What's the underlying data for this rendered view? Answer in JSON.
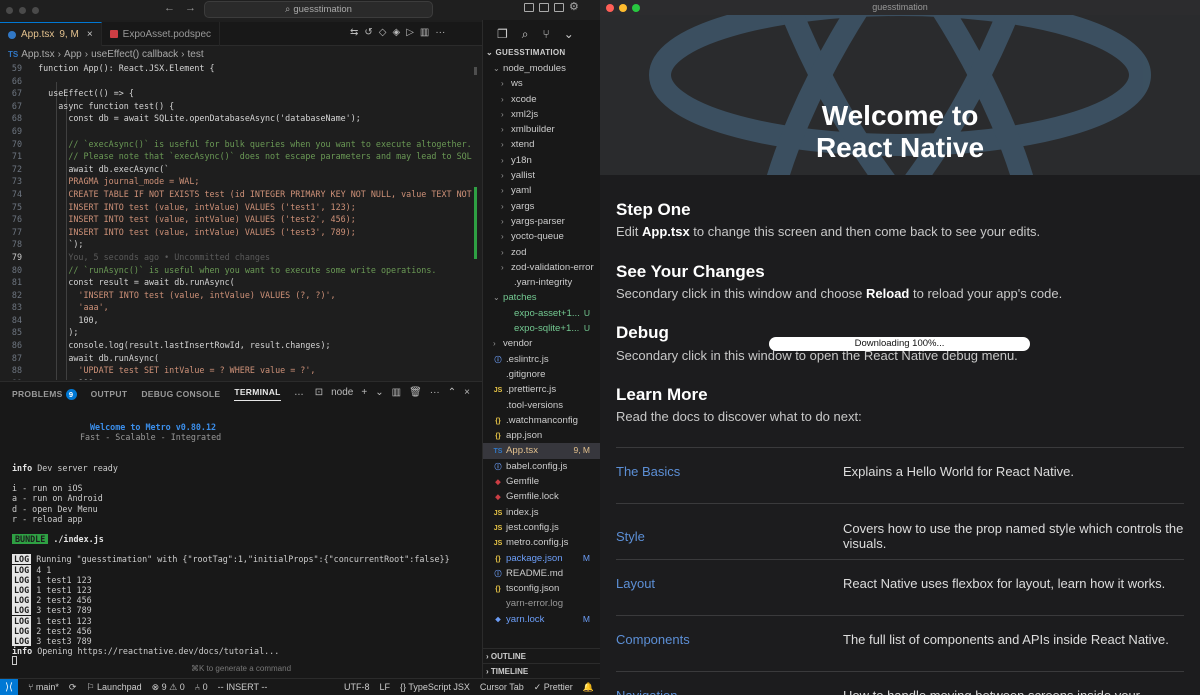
{
  "ide": {
    "search": "guesstimation",
    "tabs": [
      {
        "label": "App.tsx",
        "badge": "9, M",
        "close": "×"
      },
      {
        "label": "ExpoAsset.podspec"
      }
    ],
    "breadcrumb": [
      "App.tsx",
      "App",
      "useEffect() callback",
      "test"
    ],
    "code": [
      {
        "n": "59",
        "t": "  function App(): React.JSX.Element {",
        "k": ""
      },
      {
        "n": "66",
        "t": "",
        "k": ""
      },
      {
        "n": "67",
        "t": "    useEffect(() => {",
        "k": ""
      },
      {
        "n": "67",
        "t": "      async function test() {",
        "k": ""
      },
      {
        "n": "68",
        "t": "        const db = await SQLite.openDatabaseAsync('databaseName');",
        "k": ""
      },
      {
        "n": "69",
        "t": "",
        "k": ""
      },
      {
        "n": "70",
        "t": "        // `execAsync()` is useful for bulk queries when you want to execute altogether.",
        "k": "cmt"
      },
      {
        "n": "71",
        "t": "        // Please note that `execAsync()` does not escape parameters and may lead to SQL",
        "k": "cmt"
      },
      {
        "n": "72",
        "t": "        await db.execAsync(`",
        "k": ""
      },
      {
        "n": "73",
        "t": "        PRAGMA journal_mode = WAL;",
        "k": "str"
      },
      {
        "n": "74",
        "t": "        CREATE TABLE IF NOT EXISTS test (id INTEGER PRIMARY KEY NOT NULL, value TEXT NOT",
        "k": "str"
      },
      {
        "n": "75",
        "t": "        INSERT INTO test (value, intValue) VALUES ('test1', 123);",
        "k": "str"
      },
      {
        "n": "76",
        "t": "        INSERT INTO test (value, intValue) VALUES ('test2', 456);",
        "k": "str"
      },
      {
        "n": "77",
        "t": "        INSERT INTO test (value, intValue) VALUES ('test3', 789);",
        "k": "str"
      },
      {
        "n": "78",
        "t": "        `);",
        "k": ""
      },
      {
        "n": "79",
        "t": "        You, 5 seconds ago • Uncommitted changes",
        "k": "ghost"
      },
      {
        "n": "80",
        "t": "        // `runAsync()` is useful when you want to execute some write operations.",
        "k": "cmt"
      },
      {
        "n": "81",
        "t": "        const result = await db.runAsync(",
        "k": ""
      },
      {
        "n": "82",
        "t": "          'INSERT INTO test (value, intValue) VALUES (?, ?)',",
        "k": "str"
      },
      {
        "n": "83",
        "t": "          'aaa',",
        "k": "str"
      },
      {
        "n": "84",
        "t": "          100,",
        "k": ""
      },
      {
        "n": "85",
        "t": "        );",
        "k": ""
      },
      {
        "n": "86",
        "t": "        console.log(result.lastInsertRowId, result.changes);",
        "k": ""
      },
      {
        "n": "87",
        "t": "        await db.runAsync(",
        "k": ""
      },
      {
        "n": "88",
        "t": "          'UPDATE test SET intValue = ? WHERE value = ?',",
        "k": "str"
      },
      {
        "n": "89",
        "t": "          999,",
        "k": ""
      }
    ],
    "panel": {
      "tabs": [
        "PROBLEMS",
        "OUTPUT",
        "DEBUG CONSOLE",
        "TERMINAL"
      ],
      "problems_count": "9",
      "more": "···",
      "shell": "node",
      "terminal": {
        "welcome": "Welcome to Metro v0.80.12",
        "tagline": "Fast - Scalable - Integrated",
        "ready": "Dev server ready",
        "keys": [
          "i - run on iOS",
          "a - run on Android",
          "d - open Dev Menu",
          "r - reload app"
        ],
        "bundle": "./index.js",
        "logs": [
          "Running \"guesstimation\" with {\"rootTag\":1,\"initialProps\":{\"concurrentRoot\":false}}",
          "4 1",
          "1 test1 123",
          "1 test1 123",
          "2 test2 456",
          "3 test3 789",
          "1 test1 123",
          "2 test2 456",
          "3 test3 789"
        ],
        "opening": "Opening https://reactnative.dev/docs/tutorial...",
        "info_tag": "info",
        "log_tag": "LOG",
        "bundle_tag": "BUNDLE"
      },
      "hint": "⌘K to generate a command"
    },
    "explorer": {
      "title": "GUESSTIMATION",
      "items": [
        {
          "label": "node_modules",
          "type": "folder-open",
          "indent": 1
        },
        {
          "label": "ws",
          "type": "folder",
          "indent": 2
        },
        {
          "label": "xcode",
          "type": "folder",
          "indent": 2
        },
        {
          "label": "xml2js",
          "type": "folder",
          "indent": 2
        },
        {
          "label": "xmlbuilder",
          "type": "folder",
          "indent": 2
        },
        {
          "label": "xtend",
          "type": "folder",
          "indent": 2
        },
        {
          "label": "y18n",
          "type": "folder",
          "indent": 2
        },
        {
          "label": "yallist",
          "type": "folder",
          "indent": 2
        },
        {
          "label": "yaml",
          "type": "folder",
          "indent": 2
        },
        {
          "label": "yargs",
          "type": "folder",
          "indent": 2
        },
        {
          "label": "yargs-parser",
          "type": "folder",
          "indent": 2
        },
        {
          "label": "yocto-queue",
          "type": "folder",
          "indent": 2
        },
        {
          "label": "zod",
          "type": "folder",
          "indent": 2
        },
        {
          "label": "zod-validation-error",
          "type": "folder",
          "indent": 2
        },
        {
          "label": ".yarn-integrity",
          "type": "file",
          "indent": 2
        },
        {
          "label": "patches",
          "type": "folder-open",
          "indent": 1,
          "color": "#73c991"
        },
        {
          "label": "expo-asset+1...",
          "type": "file",
          "indent": 2,
          "color": "#73c991",
          "badge": "U"
        },
        {
          "label": "expo-sqlite+1...",
          "type": "file",
          "indent": 2,
          "color": "#73c991",
          "badge": "U"
        },
        {
          "label": "vendor",
          "type": "folder",
          "indent": 1
        },
        {
          "label": ".eslintrc.js",
          "type": "info",
          "indent": 1
        },
        {
          "label": ".gitignore",
          "type": "file",
          "indent": 1
        },
        {
          "label": ".prettierrc.js",
          "type": "js",
          "indent": 1
        },
        {
          "label": ".tool-versions",
          "type": "file",
          "indent": 1
        },
        {
          "label": ".watchmanconfig",
          "type": "json",
          "indent": 1
        },
        {
          "label": "app.json",
          "type": "json",
          "indent": 1
        },
        {
          "label": "App.tsx",
          "type": "ts",
          "indent": 1,
          "color": "#e2c08d",
          "badge": "9, M",
          "selected": true
        },
        {
          "label": "babel.config.js",
          "type": "info",
          "indent": 1
        },
        {
          "label": "Gemfile",
          "type": "ruby",
          "indent": 1
        },
        {
          "label": "Gemfile.lock",
          "type": "ruby",
          "indent": 1
        },
        {
          "label": "index.js",
          "type": "js",
          "indent": 1
        },
        {
          "label": "jest.config.js",
          "type": "js",
          "indent": 1
        },
        {
          "label": "metro.config.js",
          "type": "js",
          "indent": 1
        },
        {
          "label": "package.json",
          "type": "json",
          "indent": 1,
          "color": "#6c9ef8",
          "badge": "M"
        },
        {
          "label": "README.md",
          "type": "info",
          "indent": 1
        },
        {
          "label": "tsconfig.json",
          "type": "json",
          "indent": 1
        },
        {
          "label": "yarn-error.log",
          "type": "file",
          "indent": 1,
          "color": "#999999"
        },
        {
          "label": "yarn.lock",
          "type": "yarn",
          "indent": 1,
          "color": "#6c9ef8",
          "badge": "M"
        }
      ],
      "outline": "OUTLINE",
      "timeline": "TIMELINE"
    },
    "status": {
      "branch": "main*",
      "launchpad": "Launchpad",
      "errors": "9",
      "warnings": "0",
      "ports": "0",
      "mode": "-- INSERT --",
      "encoding": "UTF-8",
      "eol": "LF",
      "language": "TypeScript JSX",
      "tab": "Cursor Tab",
      "prettier": "Prettier"
    }
  },
  "simulator": {
    "title": "guesstimation",
    "welcome_line1": "Welcome to",
    "welcome_line2": "React Native",
    "sections": [
      {
        "title": "Step One",
        "pre": "Edit ",
        "bold": "App.tsx",
        "post": " to change this screen and then come back to see your edits."
      },
      {
        "title": "See Your Changes",
        "pre": "Secondary click in this window and choose ",
        "bold": "Reload",
        "post": " to reload your app's code."
      },
      {
        "title": "Debug",
        "pre": "Secondary click in this window to open the React Native debug menu.",
        "bold": "",
        "post": ""
      },
      {
        "title": "Learn More",
        "pre": "Read the docs to discover what to do next:",
        "bold": "",
        "post": ""
      }
    ],
    "progress": "Downloading 100%...",
    "links": [
      {
        "title": "The Basics",
        "desc": "Explains a Hello World for React Native."
      },
      {
        "title": "Style",
        "desc": "Covers how to use the prop named style which controls the visuals."
      },
      {
        "title": "Layout",
        "desc": "React Native uses flexbox for layout, learn how it works."
      },
      {
        "title": "Components",
        "desc": "The full list of components and APIs inside React Native."
      },
      {
        "title": "Navigation",
        "desc": "How to handle moving between screens inside your application."
      }
    ]
  }
}
